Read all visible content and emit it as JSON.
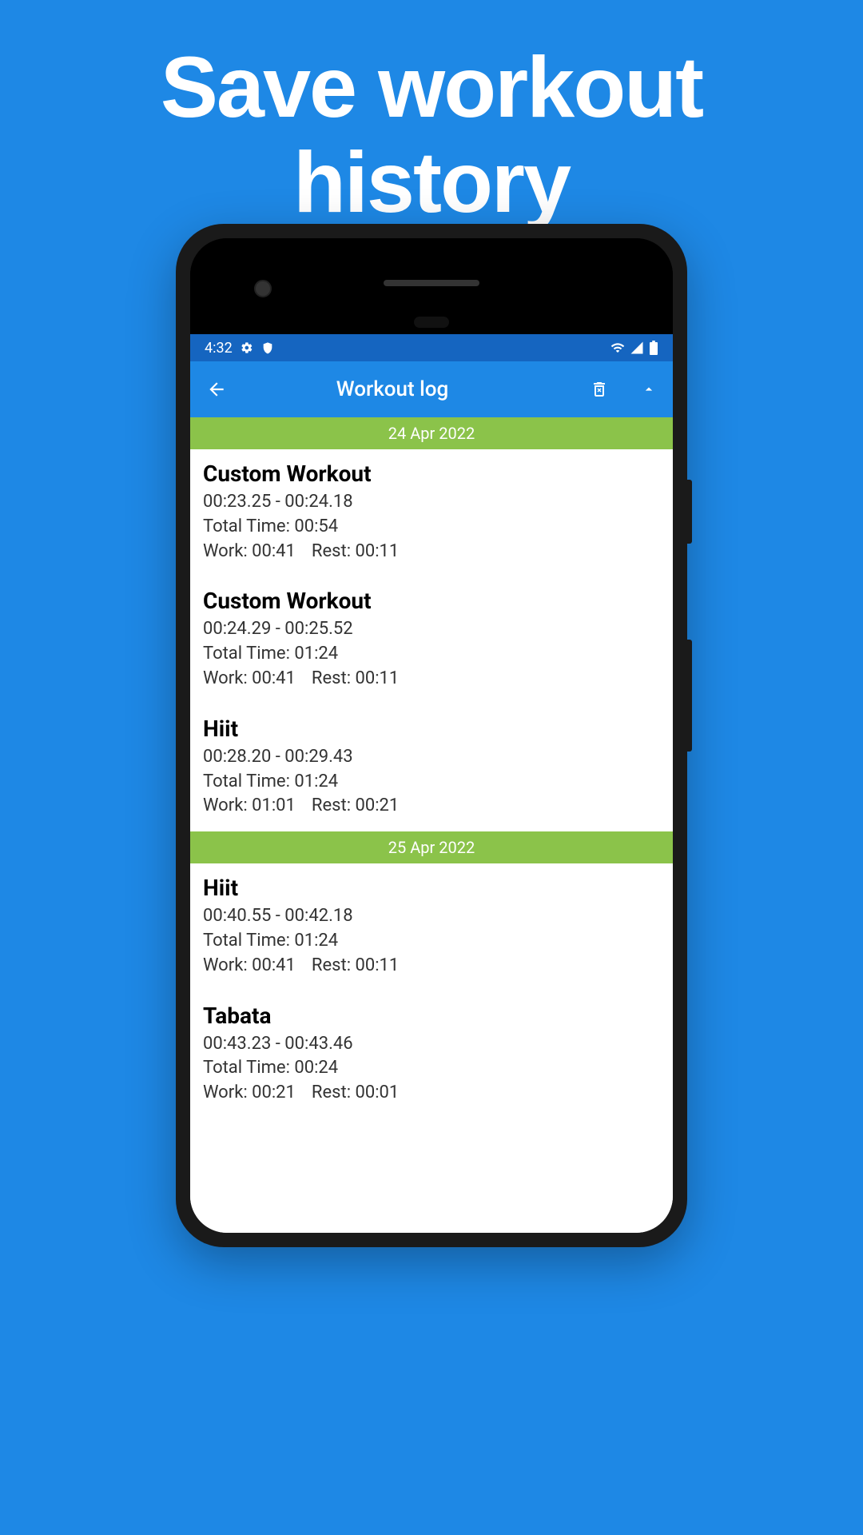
{
  "headline_line1": "Save workout",
  "headline_line2": "history",
  "status": {
    "time": "4:32"
  },
  "appbar": {
    "title": "Workout log"
  },
  "sections": [
    {
      "date": "24 Apr 2022",
      "entries": [
        {
          "title": "Custom Workout",
          "range": "00:23.25 - 00:24.18",
          "total": "Total Time: 00:54",
          "work": "Work: 00:41",
          "rest": "Rest: 00:11"
        },
        {
          "title": "Custom Workout",
          "range": "00:24.29 - 00:25.52",
          "total": "Total Time: 01:24",
          "work": "Work: 00:41",
          "rest": "Rest: 00:11"
        },
        {
          "title": "Hiit",
          "range": "00:28.20 - 00:29.43",
          "total": "Total Time: 01:24",
          "work": "Work: 01:01",
          "rest": "Rest: 00:21"
        }
      ]
    },
    {
      "date": "25 Apr 2022",
      "entries": [
        {
          "title": "Hiit",
          "range": "00:40.55 - 00:42.18",
          "total": "Total Time: 01:24",
          "work": "Work: 00:41",
          "rest": "Rest: 00:11"
        },
        {
          "title": "Tabata",
          "range": "00:43.23 - 00:43.46",
          "total": "Total Time: 00:24",
          "work": "Work: 00:21",
          "rest": "Rest: 00:01"
        }
      ]
    }
  ]
}
